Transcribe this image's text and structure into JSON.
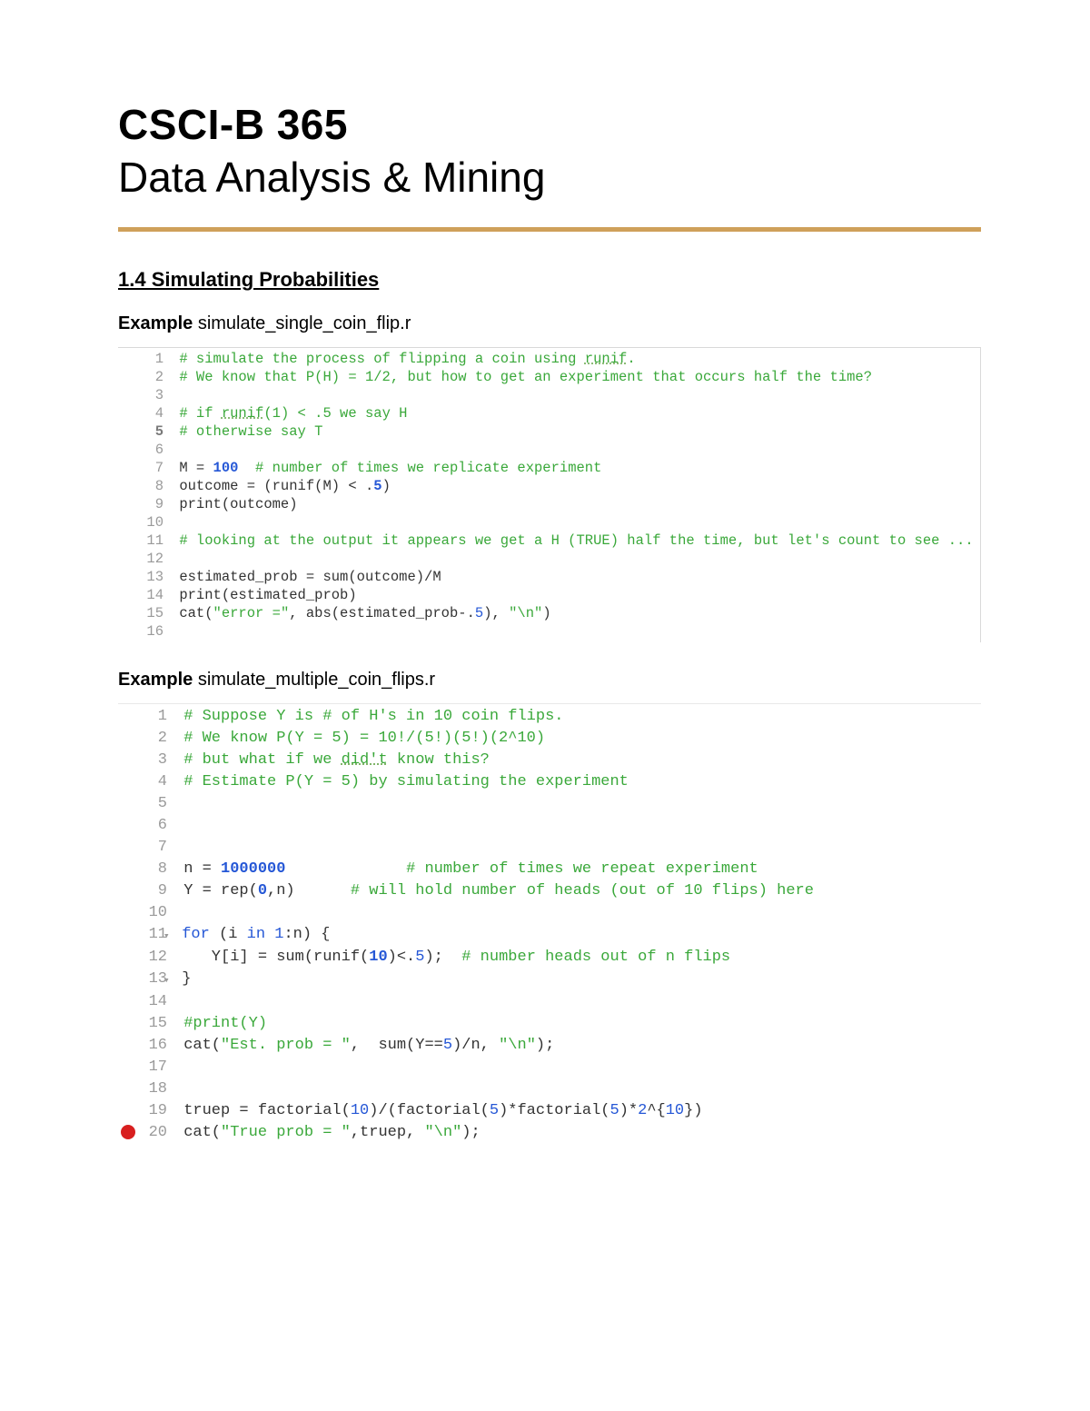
{
  "header": {
    "course_code": "CSCI-B 365",
    "course_title": "Data Analysis & Mining"
  },
  "section": {
    "title": "1.4 Simulating Probabilities"
  },
  "example1": {
    "label_prefix": "Example",
    "filename": "simulate_single_coin_flip.r",
    "lines": [
      {
        "n": "1",
        "html": "<span class='c-comment'># simulate the process of flipping a coin using <span class='u-dot'>runif</span>.</span>"
      },
      {
        "n": "2",
        "html": "<span class='c-comment'># We know that P(H) = 1/2, but how to get an experiment that occurs half the time?</span>"
      },
      {
        "n": "3",
        "html": ""
      },
      {
        "n": "4",
        "html": "<span class='c-comment'># if <span class='u-dot'>runif</span>(1) &lt; .5 we say H</span>"
      },
      {
        "n": "5",
        "bold": true,
        "html": "<span class='c-comment'># otherwise say T</span>"
      },
      {
        "n": "6",
        "html": ""
      },
      {
        "n": "7",
        "html": "<span class='c-body'>M = </span><span class='c-num'>100</span>  <span class='c-comment'># number of times we replicate experiment</span>"
      },
      {
        "n": "8",
        "html": "<span class='c-body'>outcome = (runif(M) &lt; .</span><span class='c-num'>5</span><span class='c-body'>)</span>"
      },
      {
        "n": "9",
        "html": "<span class='c-body'>print(outcome)</span>"
      },
      {
        "n": "10",
        "html": ""
      },
      {
        "n": "11",
        "html": "<span class='c-comment'># looking at the output it appears we get a H (TRUE) half the time, but let's count to see ...</span>"
      },
      {
        "n": "12",
        "html": ""
      },
      {
        "n": "13",
        "html": "<span class='c-body'>estimated_prob = sum(outcome)/M</span>"
      },
      {
        "n": "14",
        "html": "<span class='c-body'>print(estimated_prob)</span>"
      },
      {
        "n": "15",
        "html": "<span class='c-body'>cat(</span><span class='c-str'>\"error =\"</span><span class='c-body'>, abs(estimated_prob-.</span><span class='c-num-plain'>5</span><span class='c-body'>), </span><span class='c-str'>\"\\n\"</span><span class='c-body'>)</span>"
      },
      {
        "n": "16",
        "html": ""
      }
    ]
  },
  "example2": {
    "label_prefix": "Example",
    "filename": "simulate_multiple_coin_flips.r",
    "lines": [
      {
        "n": "1",
        "html": "<span class='c-comment'># Suppose Y is # of H's in 10 coin flips.</span>"
      },
      {
        "n": "2",
        "html": "<span class='c-comment'># We know P(Y = 5) = 10!/(5!)(5!)(2^10)</span>"
      },
      {
        "n": "3",
        "html": "<span class='c-comment'># but what if we <span class='u-dot'>did't</span> know this?</span>"
      },
      {
        "n": "4",
        "html": "<span class='c-comment'># Estimate P(Y = 5) by simulating the experiment</span>"
      },
      {
        "n": "5",
        "html": ""
      },
      {
        "n": "6",
        "html": ""
      },
      {
        "n": "7",
        "html": ""
      },
      {
        "n": "8",
        "html": "<span class='c-body'>n = </span><span class='c-num'>1000000</span><span class='c-body'>             </span><span class='c-comment'># number of times we repeat experiment</span>"
      },
      {
        "n": "9",
        "html": "<span class='c-body'>Y = rep(</span><span class='c-num'>0</span><span class='c-body'>,n)      </span><span class='c-comment'># will hold number of heads (out of 10 flips) here</span>"
      },
      {
        "n": "10",
        "html": ""
      },
      {
        "n": "11",
        "fold": true,
        "html": "<span class='c-kw'>for</span><span class='c-body'> (i </span><span class='c-kw'>in</span><span class='c-body'> </span><span class='c-num-plain'>1</span><span class='c-body'>:n) {</span>"
      },
      {
        "n": "12",
        "html": "<span class='c-body'>   Y[i] = sum(runif(</span><span class='c-num'>10</span><span class='c-body'>)&lt;.</span><span class='c-num-plain'>5</span><span class='c-body'>);  </span><span class='c-comment'># number heads out of n flips</span>"
      },
      {
        "n": "13",
        "fold": true,
        "html": "<span class='c-body'>}</span>"
      },
      {
        "n": "14",
        "html": ""
      },
      {
        "n": "15",
        "html": "<span class='c-comment'>#print(Y)</span>"
      },
      {
        "n": "16",
        "html": "<span class='c-body'>cat(</span><span class='c-str'>\"Est. prob = \"</span><span class='c-body'>,  sum(Y==</span><span class='c-num-plain'>5</span><span class='c-body'>)/n, </span><span class='c-str'>\"\\n\"</span><span class='c-body'>);</span>"
      },
      {
        "n": "17",
        "html": ""
      },
      {
        "n": "18",
        "html": ""
      },
      {
        "n": "19",
        "html": "<span class='c-body'>truep = factorial(</span><span class='c-num-plain'>10</span><span class='c-body'>)/(factorial(</span><span class='c-num-plain'>5</span><span class='c-body'>)*factorial(</span><span class='c-num-plain'>5</span><span class='c-body'>)*</span><span class='c-num-plain'>2</span><span class='c-body'>^{</span><span class='c-num-plain'>10</span><span class='c-body'>})</span>"
      },
      {
        "n": "20",
        "breakpoint": true,
        "html": "<span class='c-body'>cat(</span><span class='c-str'>\"True prob = \"</span><span class='c-body'>,truep, </span><span class='c-str'>\"\\n\"</span><span class='c-body'>);</span>"
      }
    ]
  }
}
